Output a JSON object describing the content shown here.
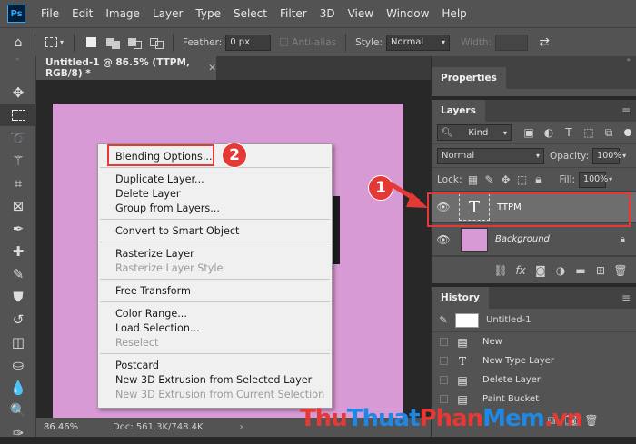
{
  "app": {
    "logo": "Ps"
  },
  "menu": [
    "File",
    "Edit",
    "Image",
    "Layer",
    "Type",
    "Select",
    "Filter",
    "3D",
    "View",
    "Window",
    "Help"
  ],
  "options": {
    "feather_label": "Feather:",
    "feather_value": "0 px",
    "antialias_label": "Anti-alias",
    "style_label": "Style:",
    "style_value": "Normal",
    "width_label": "Width:"
  },
  "document": {
    "tab_title": "Untitled-1 @ 86.5% (TTPM, RGB/8) *",
    "canvas_color": "#d89ad4",
    "zoom": "86.46%",
    "doc_info": "Doc: 561.3K/748.4K"
  },
  "context_menu": {
    "groups": [
      [
        {
          "label": "Blending Options...",
          "enabled": true
        }
      ],
      [
        {
          "label": "Duplicate Layer...",
          "enabled": true
        },
        {
          "label": "Delete Layer",
          "enabled": true
        },
        {
          "label": "Group from Layers...",
          "enabled": true
        }
      ],
      [
        {
          "label": "Convert to Smart Object",
          "enabled": true
        }
      ],
      [
        {
          "label": "Rasterize Layer",
          "enabled": true
        },
        {
          "label": "Rasterize Layer Style",
          "enabled": false
        }
      ],
      [
        {
          "label": "Free Transform",
          "enabled": true
        }
      ],
      [
        {
          "label": "Color Range...",
          "enabled": true
        },
        {
          "label": "Load Selection...",
          "enabled": true
        },
        {
          "label": "Reselect",
          "enabled": false
        }
      ],
      [
        {
          "label": "Postcard",
          "enabled": true
        },
        {
          "label": "New 3D Extrusion from Selected Layer",
          "enabled": true
        },
        {
          "label": "New 3D Extrusion from Current Selection",
          "enabled": false
        }
      ]
    ]
  },
  "annotations": {
    "badge1": "1",
    "badge2": "2",
    "accent": "#e53935"
  },
  "panels": {
    "properties_title": "Properties",
    "layers_title": "Layers",
    "kind_label": "Kind",
    "blend_mode": "Normal",
    "opacity_label": "Opacity:",
    "opacity_value": "100%",
    "lock_label": "Lock:",
    "fill_label": "Fill:",
    "fill_value": "100%",
    "layers": [
      {
        "name": "TTPM",
        "type": "text",
        "selected": true
      },
      {
        "name": "Background",
        "type": "fill",
        "locked": true
      }
    ],
    "history_title": "History",
    "history": [
      {
        "label": "Untitled-1",
        "icon": "snapshot"
      },
      {
        "label": "New",
        "icon": "document-icon"
      },
      {
        "label": "New Type Layer",
        "icon": "type-icon"
      },
      {
        "label": "Delete Layer",
        "icon": "document-icon"
      },
      {
        "label": "Paint Bucket",
        "icon": "document-icon"
      }
    ]
  },
  "watermark": {
    "part1": "Thu",
    "part2": "Thuat",
    "part3": "Phan",
    "part4": "Mem",
    ".vn": ".vn"
  }
}
